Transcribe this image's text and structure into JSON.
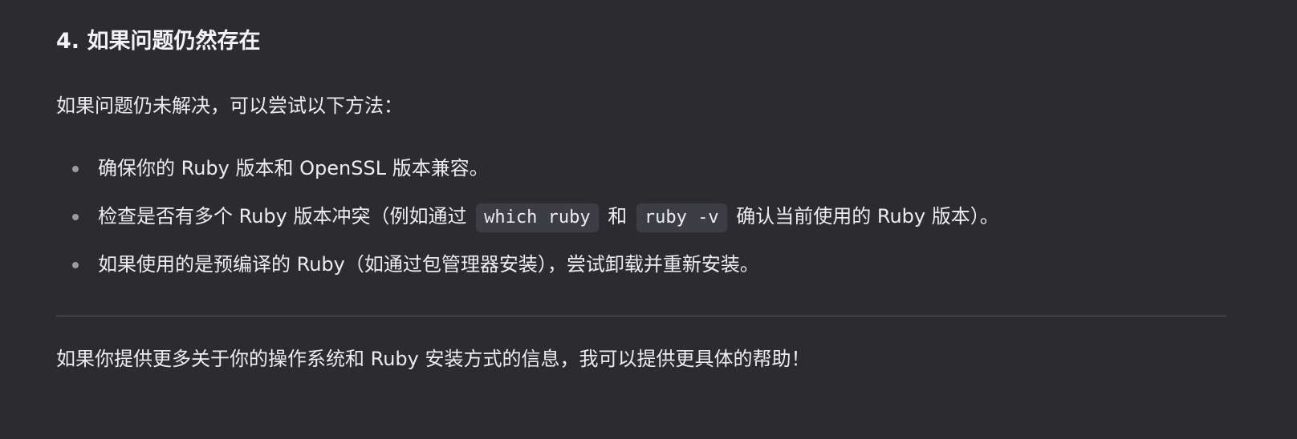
{
  "heading": "4. 如果问题仍然存在",
  "intro": "如果问题仍未解决，可以尝试以下方法：",
  "list": {
    "item1": "确保你的 Ruby 版本和 OpenSSL 版本兼容。",
    "item2": {
      "text_before": "检查是否有多个 Ruby 版本冲突（例如通过",
      "code1": "which ruby",
      "text_middle": "和",
      "code2": "ruby -v",
      "text_after": "确认当前使用的 Ruby 版本）。"
    },
    "item3": "如果使用的是预编译的 Ruby（如通过包管理器安装），尝试卸载并重新安装。"
  },
  "closing": "如果你提供更多关于你的操作系统和 Ruby 安装方式的信息，我可以提供更具体的帮助！",
  "colors": {
    "background": "#2b2b30",
    "text": "#ececf1",
    "code_background": "#3d3d44",
    "bullet": "#9a9aa0",
    "divider": "#5a5a60"
  }
}
